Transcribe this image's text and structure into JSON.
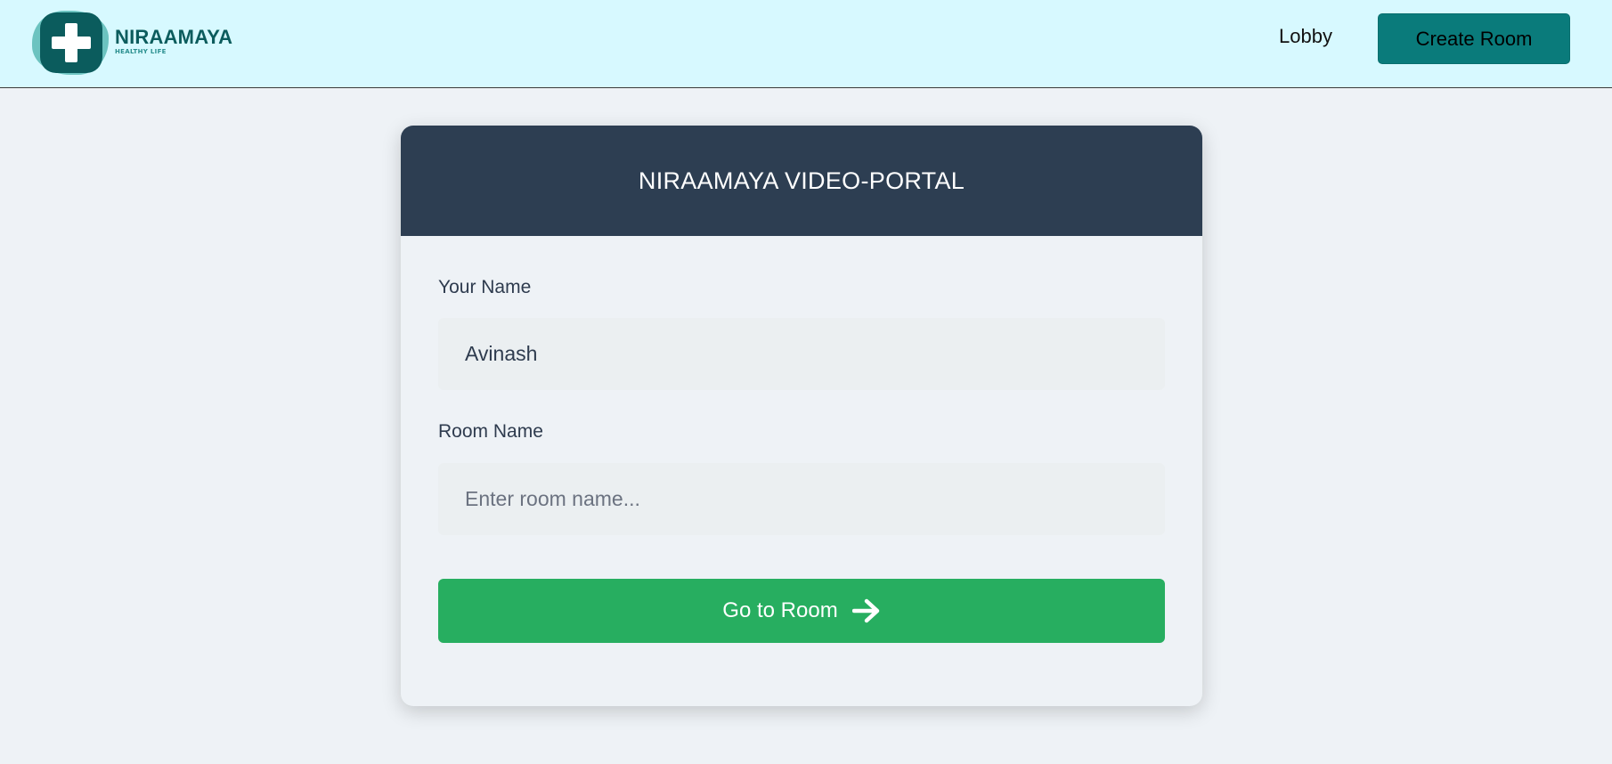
{
  "navbar": {
    "logo": {
      "name": "NIRAAMAYA",
      "tagline": "HEALTHY LIFE",
      "icon": "plus-icon"
    },
    "lobby_label": "Lobby",
    "create_room_label": "Create Room",
    "colors": {
      "background": "#d7f9ff",
      "button": "#0a7b7b",
      "brand": "#0b5c5d"
    }
  },
  "card": {
    "title": "NIRAAMAYA VIDEO-PORTAL",
    "name_field": {
      "label": "Your Name",
      "value": "Avinash",
      "placeholder": ""
    },
    "room_field": {
      "label": "Room Name",
      "value": "",
      "placeholder": "Enter room name..."
    },
    "submit_label": "Go to Room",
    "submit_icon": "arrow-right-icon",
    "colors": {
      "header": "#2d3e52",
      "submit": "#27ae60"
    }
  }
}
